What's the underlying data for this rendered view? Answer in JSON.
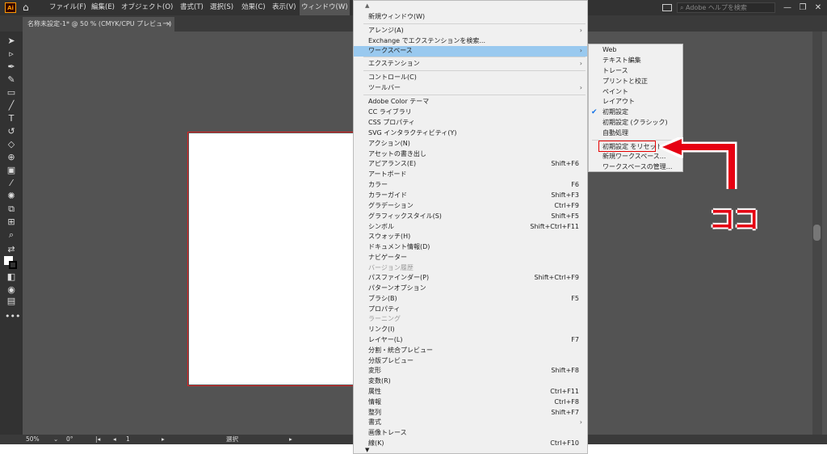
{
  "menubar": {
    "logo": "Ai",
    "items": [
      "ファイル(F)",
      "編集(E)",
      "オブジェクト(O)",
      "書式(T)",
      "選択(S)",
      "効果(C)",
      "表示(V)",
      "ウィンドウ(W)"
    ],
    "help_placeholder": "Adobe ヘルプを検索"
  },
  "document_tab": {
    "title": "名称未設定-1* @ 50 % (CMYK/CPU プレビュー)",
    "close": "×"
  },
  "statusbar": {
    "zoom": "50%",
    "rotation": "0°",
    "artboard": "1",
    "tool": "選択"
  },
  "window_menu": {
    "items": [
      {
        "label": "新規ウィンドウ(W)"
      },
      {
        "label": "アレンジ(A)",
        "submenu": true
      },
      {
        "label": "Exchange でエクステンションを検索..."
      },
      {
        "label": "ワークスペース",
        "submenu": true,
        "highlighted": true
      },
      {
        "label": "エクステンション",
        "submenu": true
      },
      {
        "label": "コントロール(C)"
      },
      {
        "label": "ツールバー",
        "submenu": true
      },
      {
        "label": "Adobe Color テーマ"
      },
      {
        "label": "CC ライブラリ"
      },
      {
        "label": "CSS プロパティ"
      },
      {
        "label": "SVG インタラクティビティ(Y)"
      },
      {
        "label": "アクション(N)"
      },
      {
        "label": "アセットの書き出し"
      },
      {
        "label": "アピアランス(E)",
        "shortcut": "Shift+F6"
      },
      {
        "label": "アートボード"
      },
      {
        "label": "カラー",
        "shortcut": "F6"
      },
      {
        "label": "カラーガイド",
        "shortcut": "Shift+F3"
      },
      {
        "label": "グラデーション",
        "shortcut": "Ctrl+F9"
      },
      {
        "label": "グラフィックスタイル(S)",
        "shortcut": "Shift+F5"
      },
      {
        "label": "シンボル",
        "shortcut": "Shift+Ctrl+F11"
      },
      {
        "label": "スウォッチ(H)"
      },
      {
        "label": "ドキュメント情報(D)"
      },
      {
        "label": "ナビゲーター"
      },
      {
        "label": "バージョン履歴",
        "disabled": true
      },
      {
        "label": "パスファインダー(P)",
        "shortcut": "Shift+Ctrl+F9"
      },
      {
        "label": "パターンオプション"
      },
      {
        "label": "ブラシ(B)",
        "shortcut": "F5"
      },
      {
        "label": "プロパティ"
      },
      {
        "label": "ラーニング",
        "disabled": true
      },
      {
        "label": "リンク(I)"
      },
      {
        "label": "レイヤー(L)",
        "shortcut": "F7"
      },
      {
        "label": "分割・統合プレビュー"
      },
      {
        "label": "分版プレビュー"
      },
      {
        "label": "変形",
        "shortcut": "Shift+F8"
      },
      {
        "label": "変数(R)"
      },
      {
        "label": "属性",
        "shortcut": "Ctrl+F11"
      },
      {
        "label": "情報",
        "shortcut": "Ctrl+F8"
      },
      {
        "label": "整列",
        "shortcut": "Shift+F7"
      },
      {
        "label": "書式",
        "submenu": true
      },
      {
        "label": "画像トレース"
      },
      {
        "label": "線(K)",
        "shortcut": "Ctrl+F10"
      }
    ]
  },
  "workspace_submenu": {
    "items": [
      {
        "label": "Web"
      },
      {
        "label": "テキスト編集"
      },
      {
        "label": "トレース"
      },
      {
        "label": "プリントと校正"
      },
      {
        "label": "ペイント"
      },
      {
        "label": "レイアウト"
      },
      {
        "label": "初期設定",
        "checked": true
      },
      {
        "label": "初期設定 (クラシック)"
      },
      {
        "label": "自動処理"
      },
      {
        "label": "初期設定 をリセット"
      },
      {
        "label": "新規ワークスペース..."
      },
      {
        "label": "ワークスペースの管理..."
      }
    ]
  },
  "annotation": {
    "text": "ココ",
    "color": "#e60012"
  }
}
